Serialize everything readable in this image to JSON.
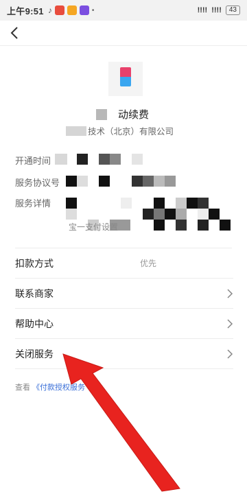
{
  "status_bar": {
    "time": "上午9:51",
    "battery": "43",
    "signal_left": "!!!!",
    "signal_right": "!!!!"
  },
  "service": {
    "title_visible": "动续费",
    "company_visible": "技术（北京）有限公司"
  },
  "info": {
    "open_time_label": "开通时间",
    "agreement_no_label": "服务协议号",
    "details_label": "服务详情",
    "details_partial": "宝一支付设置"
  },
  "menu": [
    {
      "label": "扣款方式",
      "value": "优先"
    },
    {
      "label": "联系商家"
    },
    {
      "label": "帮助中心"
    },
    {
      "label": "关闭服务"
    }
  ],
  "footer": {
    "prefix": "查看",
    "link": "《付款授权服务"
  },
  "colors": {
    "arrow": "#e8231f",
    "link": "#3a6fd8",
    "logo_top": "#e8416b",
    "logo_bottom": "#3aa6f0"
  }
}
